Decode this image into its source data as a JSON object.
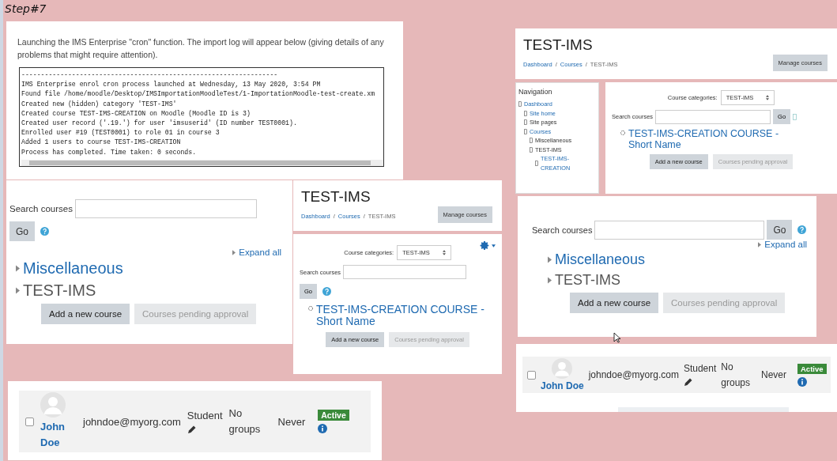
{
  "caption": "Step#7",
  "panels": [
    {
      "kind": "log",
      "intro": "Launching the IMS Enterprise \"cron\" function. The import log will appear below (giving details of any problems that might require attention).",
      "lines": [
        "------------------------------------------------------------------",
        "IMS Enterprise enrol cron process launched at Wednesday, 13 May 2020, 3:54 PM",
        "Found file /home/moodle/Desktop/IMSImportationMoodleTest/1-ImportationMoodle-test-create.xm",
        "Created new (hidden) category 'TEST-IMS'",
        "Created course TEST-IMS-CREATION on Moodle (Moodle ID is 3)",
        "Created user record ('.19.') for user 'imsuserid' (ID number TEST0001).",
        "Enrolled user #19 (TEST0001) to role 01 in course 3",
        "Added 1 users to course TEST-IMS-CREATION",
        "Process has completed. Time taken: 0 seconds."
      ]
    },
    {
      "kind": "course_search",
      "search_label": "Search courses",
      "go": "Go",
      "expand": "Expand all",
      "categories": [
        {
          "name": "Miscellaneous",
          "link": true
        },
        {
          "name": "TEST-IMS",
          "link": false
        }
      ],
      "buttons": [
        {
          "label": "Add a new course",
          "disabled": false
        },
        {
          "label": "Courses pending approval",
          "disabled": true
        }
      ]
    },
    {
      "kind": "category_page",
      "title": "TEST-IMS",
      "separator": "/",
      "breadcrumb": [
        {
          "label": "Dashboard",
          "link": true
        },
        {
          "label": "Courses",
          "link": true
        },
        {
          "label": "TEST-IMS",
          "link": false
        }
      ],
      "manage": "Manage courses",
      "settings_menu": true,
      "categories_label": "Course categories:",
      "category_value": "TEST-IMS",
      "search_label": "Search courses",
      "go": "Go",
      "course": "TEST-IMS-CREATION COURSE - Short Name",
      "buttons": [
        {
          "label": "Add a new course",
          "disabled": false
        },
        {
          "label": "Courses pending approval",
          "disabled": true
        }
      ]
    },
    {
      "kind": "participant",
      "checked": false,
      "name": "John Doe",
      "email": "johndoe@myorg.com",
      "role": "Student",
      "groups": "No groups",
      "last_access": "Never",
      "status": "Active"
    },
    {
      "kind": "category_page",
      "title": "TEST-IMS",
      "separator": "/",
      "breadcrumb": [
        {
          "label": "Dashboard",
          "link": true
        },
        {
          "label": "Courses",
          "link": true
        },
        {
          "label": "TEST-IMS",
          "link": false
        }
      ],
      "manage": "Manage courses",
      "navigation": {
        "title": "Navigation",
        "items": [
          {
            "label": "Dashboard",
            "link": true,
            "children": [
              {
                "label": "Site home",
                "link": true
              },
              {
                "label": "Site pages",
                "link": false
              },
              {
                "label": "Courses",
                "link": true,
                "children": [
                  {
                    "label": "Miscellaneous",
                    "link": false
                  },
                  {
                    "label": "TEST-IMS",
                    "link": false,
                    "children": [
                      {
                        "label": "TEST-IMS-CREATION",
                        "link": true
                      }
                    ]
                  }
                ]
              }
            ]
          }
        ]
      },
      "categories_label": "Course categories:",
      "category_value": "TEST-IMS",
      "search_label": "Search courses",
      "go": "Go",
      "course": "TEST-IMS-CREATION COURSE - Short Name",
      "buttons": [
        {
          "label": "Add a new course",
          "disabled": false
        },
        {
          "label": "Courses pending approval",
          "disabled": true
        }
      ]
    },
    {
      "kind": "course_search",
      "search_label": "Search courses",
      "go": "Go",
      "expand": "Expand all",
      "categories": [
        {
          "name": "Miscellaneous",
          "link": true
        },
        {
          "name": "TEST-IMS",
          "link": false
        }
      ],
      "buttons": [
        {
          "label": "Add a new course",
          "disabled": false
        },
        {
          "label": "Courses pending approval",
          "disabled": true
        }
      ]
    },
    {
      "kind": "participant",
      "checked": false,
      "name": "John Doe",
      "email": "johndoe@myorg.com",
      "role": "Student",
      "groups": "No groups",
      "last_access": "Never",
      "status": "Active"
    }
  ]
}
